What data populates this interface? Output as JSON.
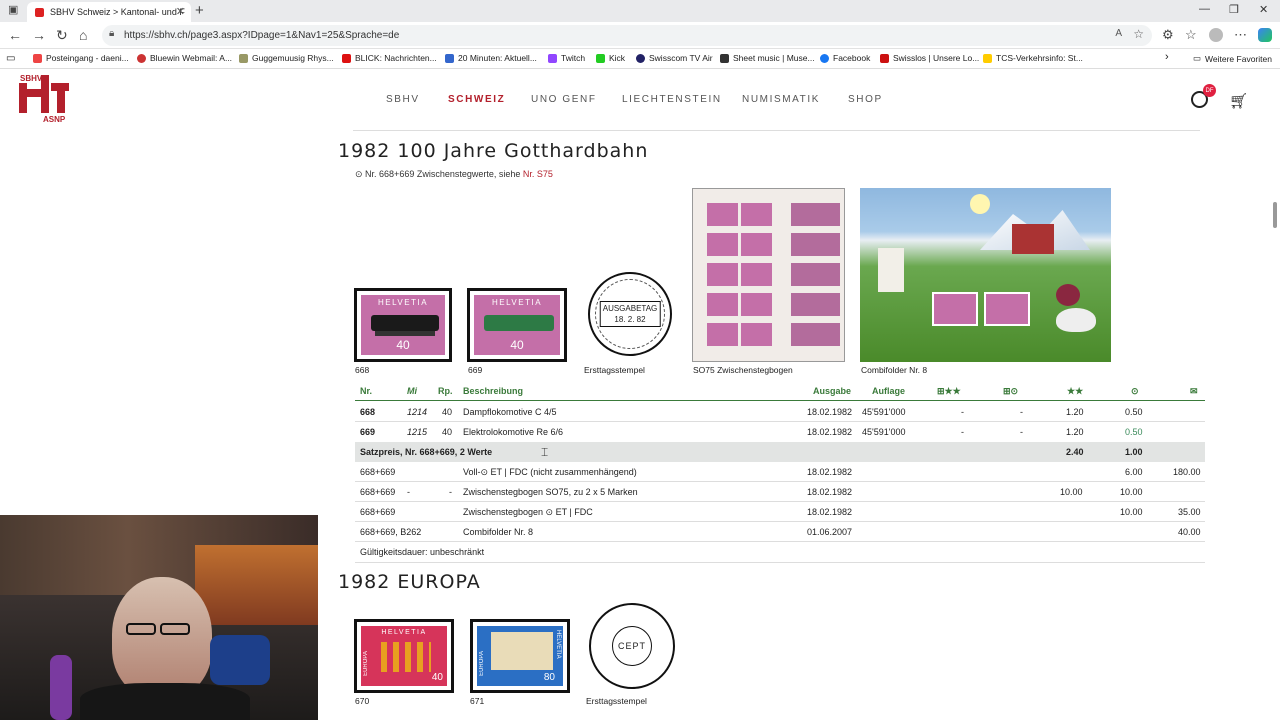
{
  "browser": {
    "tab_title": "SBHV Schweiz > Kantonal- und F",
    "url": "https://sbhv.ch/page3.aspx?IDpage=1&Nav1=25&Sprache=de",
    "bookmarks": [
      "Posteingang - daeni...",
      "Bluewin Webmail: A...",
      "Guggemuusig Rhys...",
      "BLICK: Nachrichten...",
      "20 Minuten: Aktuell...",
      "Twitch",
      "Kick",
      "Swisscom TV Air",
      "Sheet music | Muse...",
      "Facebook",
      "Swisslos | Unsere Lo...",
      "TCS-Verkehrsinfo: St..."
    ],
    "other_favorites": "Weitere Favoriten"
  },
  "logo": {
    "top": "SBHV",
    "bottom": "ASNP"
  },
  "nav": [
    "SBHV",
    "SCHWEIZ",
    "UNO GENF",
    "LIECHTENSTEIN",
    "NUMISMATIK",
    "SHOP"
  ],
  "badge": "DF",
  "section1": {
    "title": "1982 100 Jahre Gotthardbahn",
    "note_prefix": "⊙ Nr. 668+669 Zwischenstegwerte, siehe ",
    "note_link": "Nr. S75",
    "stamp_country": "HELVETIA",
    "stamp_value": "40",
    "captions": [
      "668",
      "669",
      "Ersttagsstempel",
      "SO75 Zwischenstegbogen",
      "Combifolder Nr. 8"
    ],
    "postmark_lines": [
      "AUSGABETAG",
      "18. 2. 82"
    ],
    "headers": [
      "Nr.",
      "Mi",
      "Rp.",
      "Beschreibung",
      "Ausgabe",
      "Auflage",
      "⊞★★",
      "⊞⊙",
      "★★",
      "⊙",
      "✉"
    ],
    "rows": [
      [
        "668",
        "1214",
        "40",
        "Dampflokomotive C 4/5",
        "18.02.1982",
        "45'591'000",
        "-",
        "-",
        "1.20",
        "0.50",
        ""
      ],
      [
        "669",
        "1215",
        "40",
        "Elektrolokomotive Re 6/6",
        "18.02.1982",
        "45'591'000",
        "-",
        "-",
        "1.20",
        "0.50",
        ""
      ]
    ],
    "satz": {
      "label": "Satzpreis, Nr. 668+669, 2 Werte",
      "mint": "2.40",
      "used": "1.00"
    },
    "extra_rows": [
      [
        "668+669",
        "",
        "",
        "Voll-⊙ ET | FDC (nicht zusammenhängend)",
        "18.02.1982",
        "",
        "",
        "",
        "",
        "6.00",
        "180.00"
      ],
      [
        "668+669",
        "-",
        "-",
        "Zwischenstegbogen SO75, zu 2 x 5 Marken",
        "18.02.1982",
        "",
        "",
        "",
        "10.00",
        "10.00",
        ""
      ],
      [
        "668+669",
        "",
        "",
        "Zwischenstegbogen ⊙ ET | FDC",
        "18.02.1982",
        "",
        "",
        "",
        "",
        "10.00",
        "35.00"
      ],
      [
        "668+669, B262",
        "",
        "",
        "Combifolder Nr. 8",
        "01.06.2007",
        "",
        "",
        "",
        "",
        "",
        "40.00"
      ]
    ],
    "validity": "Gültigkeitsdauer: unbeschränkt"
  },
  "section2": {
    "title": "1982 EUROPA",
    "stamp_country": "HELVETIA",
    "europa": "EUROPA",
    "values": [
      "40",
      "80"
    ],
    "captions": [
      "670",
      "671",
      "Ersttagsstempel"
    ],
    "postmark_center": "CEPT"
  },
  "colors": {
    "brand": "#b3202c",
    "header_green": "#3a7a3a"
  }
}
